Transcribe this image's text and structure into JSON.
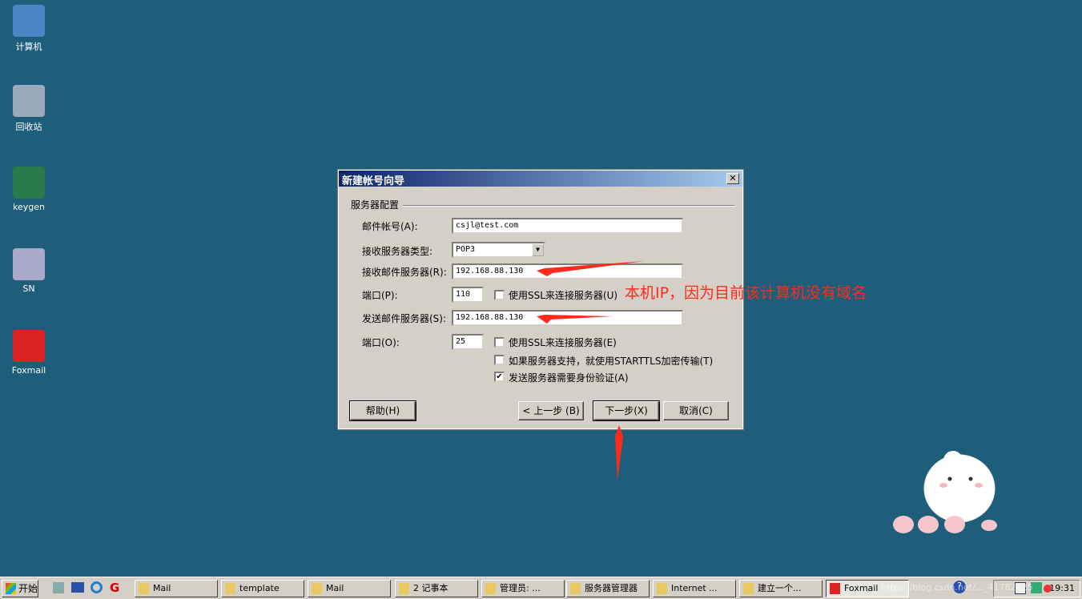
{
  "desktop": {
    "icons": [
      {
        "label": "计算机",
        "icon": "computer-icon"
      },
      {
        "label": "回收站",
        "icon": "recycle-bin-icon"
      },
      {
        "label": "keygen",
        "icon": "app-window-icon"
      },
      {
        "label": "SN",
        "icon": "settings-file-icon"
      },
      {
        "label": "Foxmail",
        "icon": "foxmail-icon"
      }
    ]
  },
  "dialog": {
    "title": "新建帐号向导",
    "section": "服务器配置",
    "account_label": "邮件帐号(A):",
    "account_value": "csjl@test.com",
    "type_label": "接收服务器类型:",
    "type_value": "POP3",
    "recv_label": "接收邮件服务器(R):",
    "recv_value": "192.168.88.130",
    "port1_label": "端口(P):",
    "port1_value": "110",
    "ssl1_label": "使用SSL来连接服务器(U)",
    "send_label": "发送邮件服务器(S):",
    "send_value": "192.168.88.130",
    "port2_label": "端口(O):",
    "port2_value": "25",
    "ssl2_label": "使用SSL来连接服务器(E)",
    "starttls_label": "如果服务器支持，就使用STARTTLS加密传输(T)",
    "auth_label": "发送服务器需要身份验证(A)",
    "checks": {
      "ssl1": false,
      "ssl2": false,
      "starttls": false,
      "auth": true
    },
    "help": "帮助(H)",
    "back": "< 上一步 (B)",
    "next": "下一步(X)",
    "cancel": "取消(C)"
  },
  "annotation": {
    "text": "本机IP，因为目前该计算机没有域名",
    "color": "#ff2a1a"
  },
  "taskbar": {
    "start": "开始",
    "items": [
      "Mail",
      "template",
      "Mail",
      "2 记事本",
      "管理员: ...",
      "服务器管理器",
      "Internet ...",
      "建立一个...",
      "Foxmail"
    ],
    "clock": "19:31",
    "watermark": "https://blog.csdn.net/..._41782425"
  }
}
